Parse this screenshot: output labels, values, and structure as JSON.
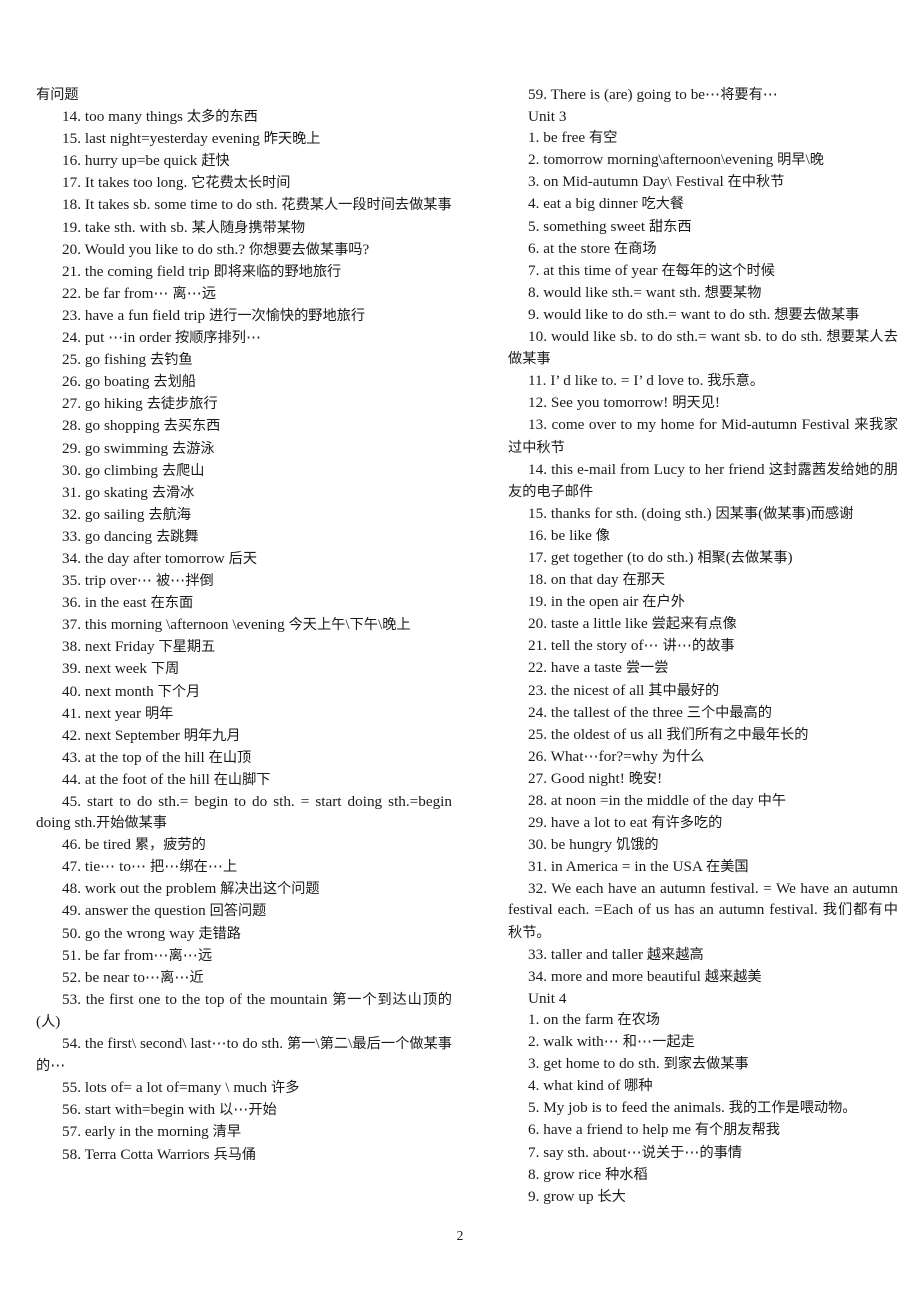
{
  "document": {
    "page_number": "2",
    "left_column": [
      {
        "text": "有问题",
        "indent": false
      },
      {
        "text": "14. too many things  太多的东西",
        "indent": true
      },
      {
        "text": "15. last night=yesterday evening  昨天晚上",
        "indent": true
      },
      {
        "text": "16. hurry up=be quick  赶快",
        "indent": true
      },
      {
        "text": "17. It takes too long.  它花费太长时间",
        "indent": true
      },
      {
        "text": "18. It takes sb. some time to do sth.  花费某人一段时间去做某事",
        "indent": true
      },
      {
        "text": "19. take sth. with sb.  某人随身携带某物",
        "indent": true
      },
      {
        "text": "20. Would you like to do sth.?  你想要去做某事吗?",
        "indent": true
      },
      {
        "text": "21. the coming field trip  即将来临的野地旅行",
        "indent": true
      },
      {
        "text": "22. be far from⋯  离⋯远",
        "indent": true
      },
      {
        "text": "23. have a fun field trip  进行一次愉快的野地旅行",
        "indent": true
      },
      {
        "text": "24. put  ⋯in order  按顺序排列⋯",
        "indent": true
      },
      {
        "text": "25. go fishing  去钓鱼",
        "indent": true
      },
      {
        "text": "26. go boating  去划船",
        "indent": true
      },
      {
        "text": "27. go hiking  去徒步旅行",
        "indent": true
      },
      {
        "text": "28. go shopping  去买东西",
        "indent": true
      },
      {
        "text": "29. go swimming  去游泳",
        "indent": true
      },
      {
        "text": "30. go climbing  去爬山",
        "indent": true
      },
      {
        "text": "31. go skating  去滑冰",
        "indent": true
      },
      {
        "text": "32. go sailing  去航海",
        "indent": true
      },
      {
        "text": "33. go dancing  去跳舞",
        "indent": true
      },
      {
        "text": "34. the day after tomorrow  后天",
        "indent": true
      },
      {
        "text": "35. trip over⋯  被⋯拌倒",
        "indent": true
      },
      {
        "text": "36. in the east  在东面",
        "indent": true
      },
      {
        "text": "37.  this  morning  \\afternoon  \\evening  今天上午\\下午\\晚上",
        "indent": true
      },
      {
        "text": "38. next Friday  下星期五",
        "indent": true
      },
      {
        "text": "39. next week  下周",
        "indent": true
      },
      {
        "text": "40. next month  下个月",
        "indent": true
      },
      {
        "text": "41. next year  明年",
        "indent": true
      },
      {
        "text": "42. next September  明年九月",
        "indent": true
      },
      {
        "text": "43. at the top of the hill  在山顶",
        "indent": true
      },
      {
        "text": "44. at the foot of the hill  在山脚下",
        "indent": true
      },
      {
        "text": "45.  start  to  do  sth.=  begin  to  do  sth. =  start  doing sth.=begin doing sth.开始做某事",
        "indent": true
      },
      {
        "text": "46. be tired  累，疲劳的",
        "indent": true
      },
      {
        "text": "47. tie⋯  to⋯  把⋯绑在⋯上",
        "indent": true
      },
      {
        "text": "48. work out the problem  解决出这个问题",
        "indent": true
      },
      {
        "text": "49. answer the question  回答问题",
        "indent": true
      },
      {
        "text": "50. go the wrong way  走错路",
        "indent": true
      },
      {
        "text": "51. be far from⋯离⋯远",
        "indent": true
      },
      {
        "text": "52. be near to⋯离⋯近",
        "indent": true
      },
      {
        "text": "53. the first one to the top of the mountain  第一个到达山顶的(人)",
        "indent": true
      },
      {
        "text": "54. the first\\ second\\ last⋯to do sth.  第一\\第二\\最后一个做某事的⋯",
        "indent": true
      },
      {
        "text": "55. lots of= a lot of=many \\ much  许多",
        "indent": true
      },
      {
        "text": "56. start with=begin with  以⋯开始",
        "indent": true
      },
      {
        "text": "57. early in the morning  清早",
        "indent": true
      },
      {
        "text": "58. Terra Cotta Warriors  兵马俑",
        "indent": true
      }
    ],
    "right_column": [
      {
        "text": "59. There is (are) going to be⋯将要有⋯",
        "indent": true
      },
      {
        "text": "Unit 3",
        "indent": true
      },
      {
        "text": "1. be free  有空",
        "indent": true
      },
      {
        "text": "2. tomorrow morning\\afternoon\\evening  明早\\晚",
        "indent": true
      },
      {
        "text": "3. on Mid-autumn Day\\ Festival  在中秋节",
        "indent": true
      },
      {
        "text": "4. eat a big dinner  吃大餐",
        "indent": true
      },
      {
        "text": "5. something sweet  甜东西",
        "indent": true
      },
      {
        "text": "6. at the store  在商场",
        "indent": true
      },
      {
        "text": "7. at this time of year  在每年的这个时候",
        "indent": true
      },
      {
        "text": "8. would like sth.= want sth.  想要某物",
        "indent": true
      },
      {
        "text": "9. would like to do sth.= want to do sth.  想要去做某事",
        "indent": true
      },
      {
        "text": "10.  would  like  sb.  to  do  sth.=  want  sb.  to  do  sth.  想要某人去做某事",
        "indent": true
      },
      {
        "text": "11. I’ d like to. = I’ d love to.  我乐意。",
        "indent": true
      },
      {
        "text": "12. See you tomorrow!  明天见!",
        "indent": true
      },
      {
        "text": "13. come over to my home for Mid-autumn Festival  来我家过中秋节",
        "indent": true
      },
      {
        "text": "14. this e-mail from Lucy to her friend  这封露茜发给她的朋友的电子邮件",
        "indent": true
      },
      {
        "text": "15. thanks for sth. (doing sth.)  因某事(做某事)而感谢",
        "indent": true
      },
      {
        "text": "16. be like  像",
        "indent": true
      },
      {
        "text": "17. get together (to do sth.)  相聚(去做某事)",
        "indent": true
      },
      {
        "text": "18. on that day  在那天",
        "indent": true
      },
      {
        "text": "19. in the open air  在户外",
        "indent": true
      },
      {
        "text": "20. taste a little like  尝起来有点像",
        "indent": true
      },
      {
        "text": "21. tell the story of⋯  讲⋯的故事",
        "indent": true
      },
      {
        "text": "22. have a taste  尝一尝",
        "indent": true
      },
      {
        "text": "23. the nicest of all  其中最好的",
        "indent": true
      },
      {
        "text": "24. the tallest of the three  三个中最高的",
        "indent": true
      },
      {
        "text": "25. the oldest of us all  我们所有之中最年长的",
        "indent": true
      },
      {
        "text": "26. What⋯for?=why  为什么",
        "indent": true
      },
      {
        "text": "27. Good night!  晚安!",
        "indent": true
      },
      {
        "text": "28. at noon =in the middle of the day  中午",
        "indent": true
      },
      {
        "text": "29. have a lot to eat  有许多吃的",
        "indent": true
      },
      {
        "text": "30. be hungry  饥饿的",
        "indent": true
      },
      {
        "text": "31. in America = in the USA  在美国",
        "indent": true
      },
      {
        "text": "32.  We  each  have  an  autumn  festival. =  We  have  an autumn festival each. =Each of us has an autumn festival.  我们都有中秋节。",
        "indent": true
      },
      {
        "text": "33. taller and taller  越来越高",
        "indent": true
      },
      {
        "text": "34. more and more beautiful  越来越美",
        "indent": true
      },
      {
        "text": "Unit 4",
        "indent": true
      },
      {
        "text": "1. on the farm  在农场",
        "indent": true
      },
      {
        "text": "2. walk with⋯  和⋯一起走",
        "indent": true
      },
      {
        "text": "3. get home to do sth.  到家去做某事",
        "indent": true
      },
      {
        "text": "4. what kind of  哪种",
        "indent": true
      },
      {
        "text": "5. My job is to feed the animals.  我的工作是喂动物。",
        "indent": true
      },
      {
        "text": "6. have a friend to help me  有个朋友帮我",
        "indent": true
      },
      {
        "text": "7. say sth. about⋯说关于⋯的事情",
        "indent": true
      },
      {
        "text": "8. grow rice  种水稻",
        "indent": true
      },
      {
        "text": "9. grow up  长大",
        "indent": true
      }
    ]
  }
}
